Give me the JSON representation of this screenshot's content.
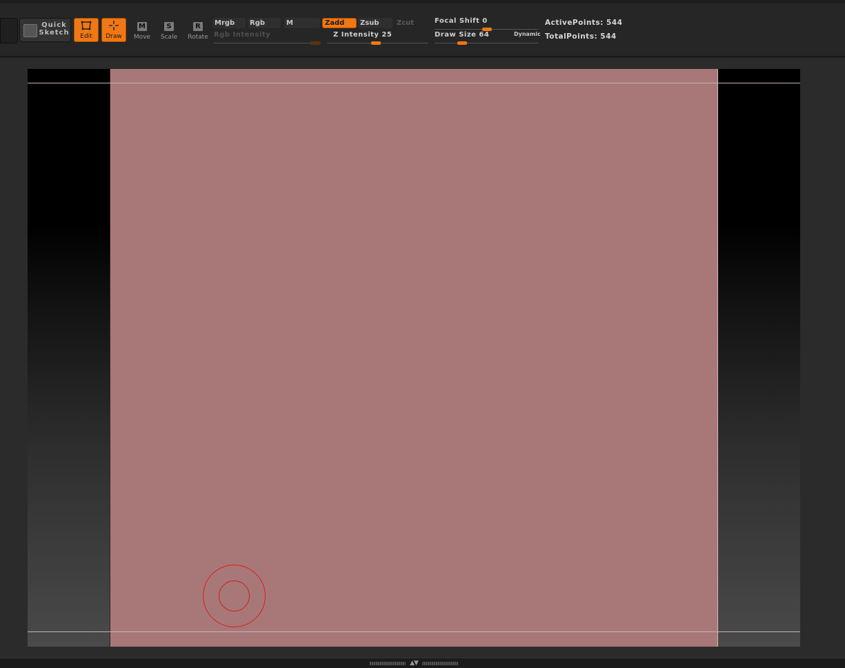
{
  "toolbar": {
    "quick_sketch_label": "Quick Sketch",
    "edit_label": "Edit",
    "draw_label": "Draw",
    "move_label": "Move",
    "move_key": "M",
    "scale_label": "Scale",
    "scale_key": "S",
    "rotate_label": "Rotate",
    "rotate_key": "R"
  },
  "modes": {
    "mrgb": "Mrgb",
    "rgb": "Rgb",
    "m": "M",
    "zadd": "Zadd",
    "zsub": "Zsub",
    "zcut": "Zcut"
  },
  "sliders": {
    "rgb_intensity_label": "Rgb Intensity",
    "z_intensity_label": "Z Intensity",
    "z_intensity_value": "25",
    "focal_shift_label": "Focal Shift",
    "focal_shift_value": "0",
    "draw_size_label": "Draw Size",
    "draw_size_value": "64",
    "dynamic_label": "Dynamic"
  },
  "stats": {
    "active_points_label": "ActivePoints:",
    "active_points_value": "544",
    "total_points_label": "TotalPoints:",
    "total_points_value": "544"
  },
  "icons": {
    "quick_sketch": "quick-sketch-icon",
    "edit": "edit-icon",
    "draw": "draw-icon",
    "move": "move-icon",
    "scale": "scale-icon",
    "rotate": "rotate-icon",
    "brush_cursor": "brush-cursor-icon",
    "bottom_toggle": "expand-collapse-icon"
  },
  "colors": {
    "accent": "#f07814",
    "document_fill": "#a87878",
    "brush_cursor": "#e01818"
  }
}
